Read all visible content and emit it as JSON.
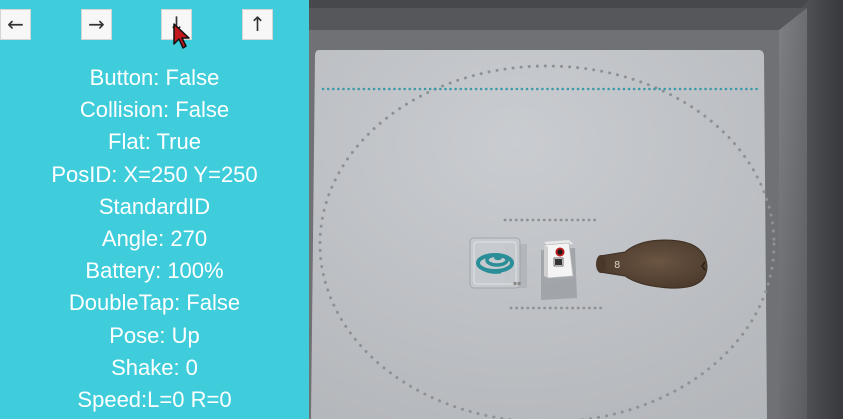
{
  "nav": {
    "left_label": "←",
    "right_label": "→",
    "down_label": "↓",
    "up_label": "↑"
  },
  "status": [
    "Button: False",
    "Collision: False",
    "Flat: True",
    "PosID: X=250 Y=250",
    "StandardID",
    "Angle: 270",
    "Battery: 100%",
    "DoubleTap: False",
    "Pose: Up",
    "Shake: 0",
    "Speed:L=0 R=0"
  ],
  "colors": {
    "panel": "#40cddb",
    "mat": "#c3c6ca",
    "frame": "#4a4b4f",
    "dots_blue": "#3a9aa8",
    "dots_gray": "#8e9195",
    "brown": "#5b4634"
  },
  "icons": {
    "cursor": "mouse-pointer-icon"
  }
}
